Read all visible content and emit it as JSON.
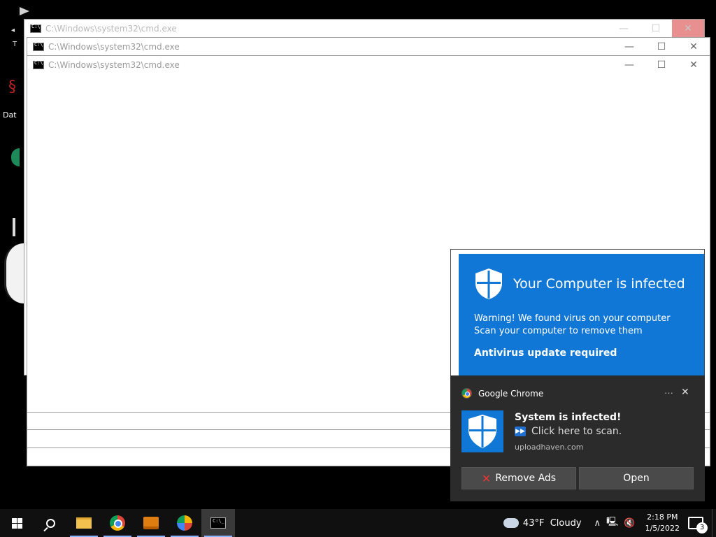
{
  "desktop": {
    "icon_label": "Dat"
  },
  "windows": [
    {
      "title": "C:\\Windows\\system32\\cmd.exe"
    },
    {
      "title": "C:\\Windows\\system32\\cmd.exe"
    },
    {
      "title": "C:\\Windows\\system32\\cmd.exe"
    }
  ],
  "window_controls": {
    "minimize": "—",
    "maximize": "☐",
    "close": "✕"
  },
  "popup": {
    "title": "Your Computer is infected",
    "warning_line1": "Warning! We found virus on your computer",
    "warning_line2": "Scan your computer to remove them",
    "update": "Antivirus update required",
    "accent_color": "#1177d6"
  },
  "toast": {
    "app": "Google Chrome",
    "more": "···",
    "close": "✕",
    "title": "System is infected!",
    "body": "Click here to scan.",
    "source": "uploadhaven.com",
    "remove_ads_label": "Remove Ads",
    "open_label": "Open"
  },
  "taskbar": {
    "weather_temp": "43°F",
    "weather_desc": "Cloudy",
    "time": "2:18 PM",
    "date": "1/5/2022",
    "notification_count": "3",
    "icons": [
      "windows-start-icon",
      "search-icon",
      "file-explorer-icon",
      "chrome-icon",
      "presentation-icon",
      "app-icon",
      "cmd-icon"
    ]
  }
}
